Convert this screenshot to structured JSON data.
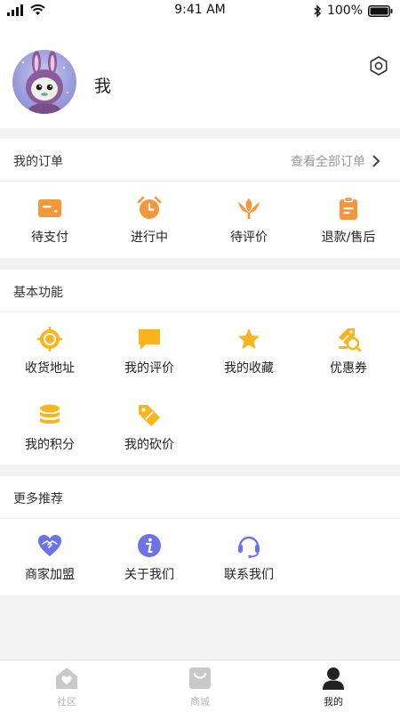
{
  "status_bar": {
    "time": "9:41 AM",
    "battery": "100%"
  },
  "profile": {
    "name": "我"
  },
  "orders": {
    "title": "我的订单",
    "view_all": "查看全部订单",
    "items": [
      {
        "label": "待支付",
        "icon": "wallet-card-icon"
      },
      {
        "label": "进行中",
        "icon": "alarm-clock-icon"
      },
      {
        "label": "待评价",
        "icon": "tulip-icon"
      },
      {
        "label": "退款/售后",
        "icon": "clipboard-icon"
      }
    ]
  },
  "basic": {
    "title": "基本功能",
    "items": [
      {
        "label": "收货地址",
        "icon": "location-target-icon"
      },
      {
        "label": "我的评价",
        "icon": "chat-bubble-icon"
      },
      {
        "label": "我的收藏",
        "icon": "star-icon"
      },
      {
        "label": "优惠券",
        "icon": "coupon-icon"
      },
      {
        "label": "我的积分",
        "icon": "coin-stack-icon"
      },
      {
        "label": "我的砍价",
        "icon": "price-tag-icon"
      }
    ]
  },
  "more": {
    "title": "更多推荐",
    "items": [
      {
        "label": "商家加盟",
        "icon": "handshake-heart-icon"
      },
      {
        "label": "关于我们",
        "icon": "info-icon"
      },
      {
        "label": "联系我们",
        "icon": "headset-icon"
      }
    ]
  },
  "tabbar": {
    "items": [
      {
        "label": "社区",
        "icon": "home-heart-icon",
        "active": false
      },
      {
        "label": "商城",
        "icon": "shopping-bag-icon",
        "active": false
      },
      {
        "label": "我的",
        "icon": "user-icon",
        "active": true
      }
    ]
  },
  "colors": {
    "orange": "#f5963c",
    "yellow": "#f9b51c",
    "purple": "#6d73e6",
    "active_tab": "#222222",
    "inactive_tab": "#b5b5b5"
  }
}
